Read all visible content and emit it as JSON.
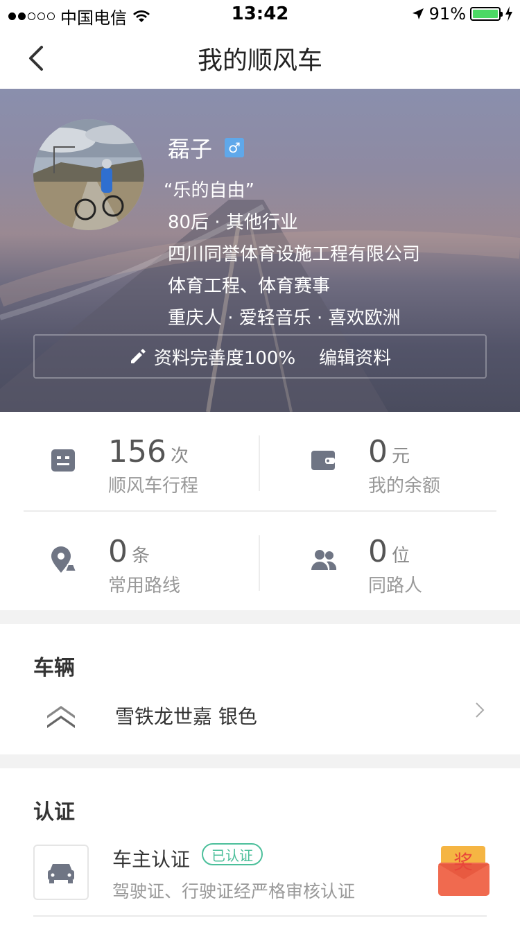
{
  "status_bar": {
    "carrier": "中国电信",
    "time": "13:42",
    "battery": "91%"
  },
  "nav": {
    "title": "我的顺风车"
  },
  "profile": {
    "name": "磊子",
    "gender_icon": "male-symbol",
    "gender_symbol": "♂",
    "motto": "“乐的自由”",
    "lines": [
      "80后 · 其他行业",
      "四川同誉体育设施工程有限公司",
      "体育工程、体育赛事",
      "重庆人 · 爱轻音乐 · 喜欢欧洲"
    ],
    "completeness": "资料完善度100%",
    "edit_label": "编辑资料"
  },
  "stats": [
    {
      "value": "156",
      "unit": "次",
      "label": "顺风车行程",
      "icon": "calendar-icon"
    },
    {
      "value": "0",
      "unit": "元",
      "label": "我的余额",
      "icon": "wallet-icon"
    },
    {
      "value": "0",
      "unit": "条",
      "label": "常用路线",
      "icon": "location-pin-icon"
    },
    {
      "value": "0",
      "unit": "位",
      "label": "同路人",
      "icon": "people-icon"
    }
  ],
  "vehicle": {
    "title": "车辆",
    "car": "雪铁龙世嘉 银色"
  },
  "certification": {
    "title": "认证",
    "name": "车主认证",
    "badge": "已认证",
    "desc": "驾驶证、行驶证经严格审核认证",
    "reward": "奖"
  },
  "colors": {
    "accent_green": "#4bbf9a",
    "gender_blue": "#5fa8ea",
    "reward_red": "#f06a4f"
  }
}
